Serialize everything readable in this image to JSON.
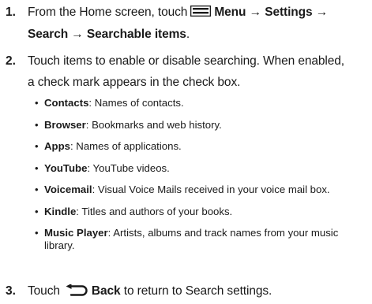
{
  "steps": [
    {
      "number": "1.",
      "text_before_icon": "From the Home screen, touch",
      "icon_label": "menu-icon",
      "line1_bold": "Menu → Settings →",
      "line2_bold": "Search → Searchable items",
      "line2_tail": "."
    },
    {
      "number": "2.",
      "line1": "Touch items to enable or disable searching. When enabled,",
      "line2": "a check mark appears in the check box."
    },
    {
      "number": "3.",
      "text_before_icon": "Touch",
      "icon_label": "back-icon",
      "bold": "Back",
      "text_after": "to return to Search settings."
    }
  ],
  "bullets": [
    {
      "term": "Contacts",
      "desc": ": Names of contacts."
    },
    {
      "term": "Browser",
      "desc": ": Bookmarks and web history."
    },
    {
      "term": "Apps",
      "desc": ": Names of applications."
    },
    {
      "term": "YouTube",
      "desc": ": YouTube videos."
    },
    {
      "term": "Voicemail",
      "desc": ": Visual Voice Mails received in your voice mail box."
    },
    {
      "term": "Kindle",
      "desc": ": Titles and authors of your books."
    },
    {
      "term": "Music Player",
      "desc": ": Artists, albums and track names from your music",
      "desc2": "library."
    }
  ],
  "bullet_glyph": "•"
}
